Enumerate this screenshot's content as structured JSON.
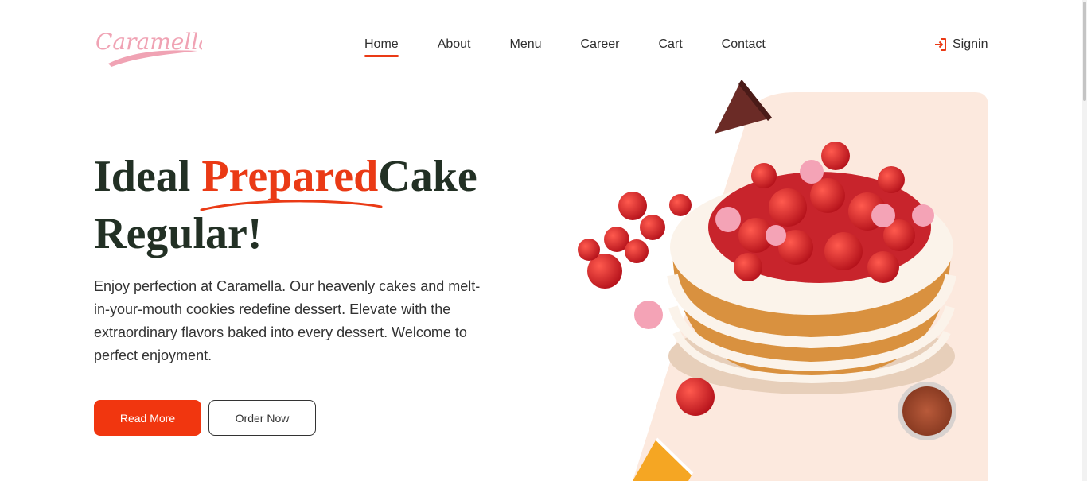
{
  "brand": {
    "logo_text": "Caramella"
  },
  "nav": {
    "items": [
      {
        "label": "Home",
        "active": true
      },
      {
        "label": "About",
        "active": false
      },
      {
        "label": "Menu",
        "active": false
      },
      {
        "label": "Career",
        "active": false
      },
      {
        "label": "Cart",
        "active": false
      },
      {
        "label": "Contact",
        "active": false
      }
    ],
    "signin_label": "Signin",
    "signin_icon": "login-icon"
  },
  "hero": {
    "title_part1": "Ideal ",
    "title_accent": "Prepared",
    "title_part2": "Cake",
    "title_line2": "Regular!",
    "description": "Enjoy perfection at Caramella. Our heavenly cakes and melt-in-your-mouth cookies redefine dessert. Elevate with the extraordinary flavors baked into every dessert. Welcome to perfect enjoyment.",
    "read_more_label": "Read More",
    "order_now_label": "Order Now"
  },
  "colors": {
    "accent": "#ea3a15",
    "button": "#f1360f",
    "title": "#223024",
    "logo": "#f0a3b4",
    "panel": "#fce9de"
  }
}
